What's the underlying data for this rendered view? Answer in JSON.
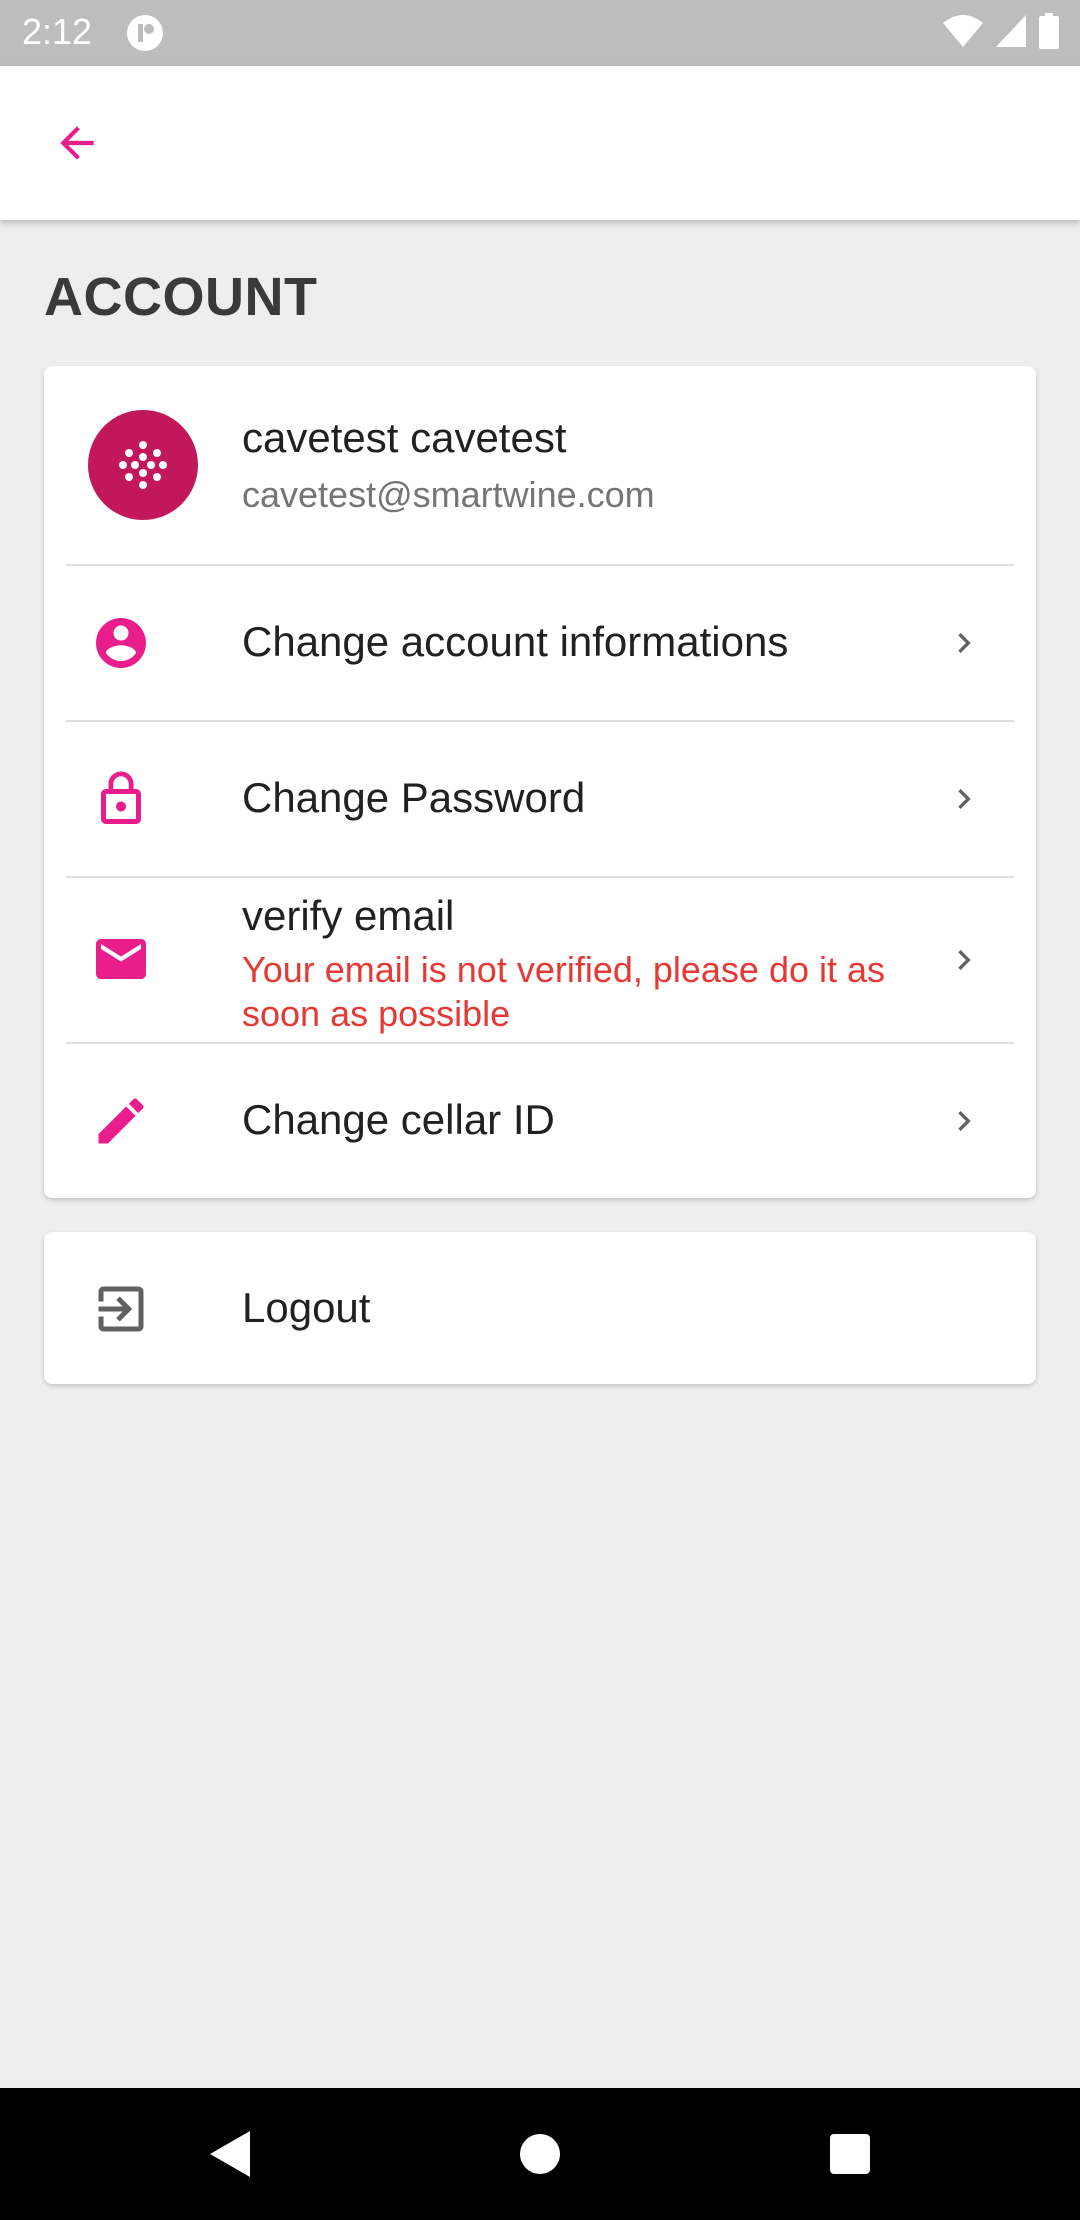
{
  "status_bar": {
    "time": "2:12"
  },
  "header": {
    "back_icon": "arrow-back-icon"
  },
  "page": {
    "title": "ACCOUNT"
  },
  "profile": {
    "name": "cavetest cavetest",
    "email": "cavetest@smartwine.com",
    "avatar_color": "#c2185b"
  },
  "menu": {
    "items": [
      {
        "label": "Change account informations",
        "icon": "account-circle-icon"
      },
      {
        "label": "Change Password",
        "icon": "lock-icon"
      },
      {
        "label": "verify email",
        "subtitle": "Your email is not verified, please do it as soon as possible",
        "icon": "mail-icon"
      },
      {
        "label": "Change cellar ID",
        "icon": "pencil-icon"
      }
    ]
  },
  "logout": {
    "label": "Logout",
    "icon": "logout-icon"
  },
  "colors": {
    "accent": "#e91e8c",
    "warning": "#e53935",
    "background": "#eeeeee"
  }
}
